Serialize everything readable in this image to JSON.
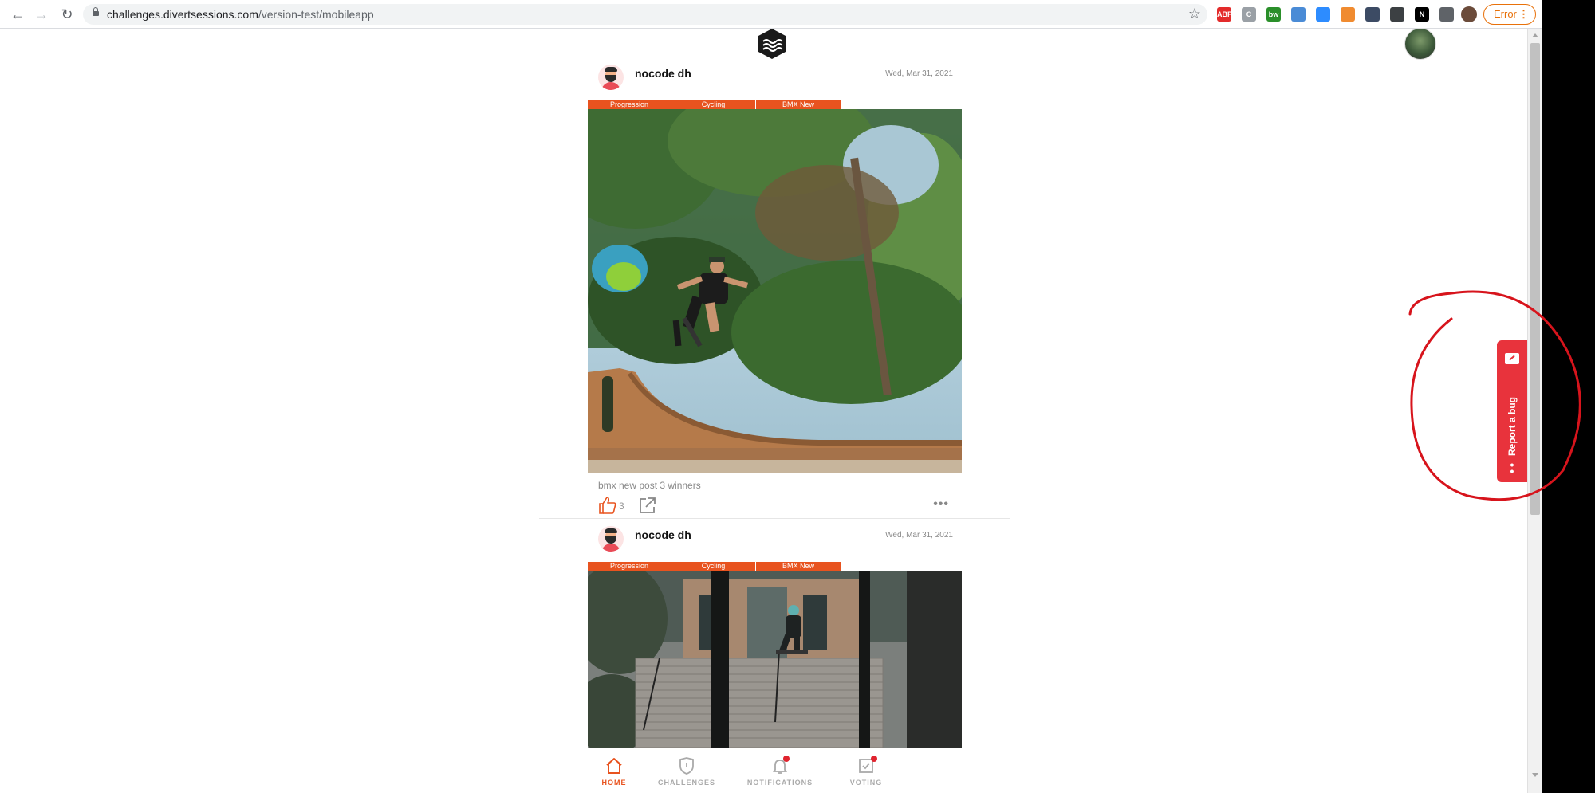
{
  "browser": {
    "url_domain": "challenges.divertsessions.com",
    "url_path": "/version-test/mobileapp",
    "error_label": "Error",
    "extensions": [
      {
        "name": "adblock-icon",
        "text": "ABP",
        "color": "#e32b2b"
      },
      {
        "name": "clipboard-ext-icon",
        "text": "C",
        "color": "#9aa0a6"
      },
      {
        "name": "bw-ext-icon",
        "text": "bw",
        "color": "#2a8f2a"
      },
      {
        "name": "image-ext-icon",
        "text": "",
        "color": "#4a8bd6"
      },
      {
        "name": "zoom-ext-icon",
        "text": "",
        "color": "#2d8cff"
      },
      {
        "name": "grid-ext-icon",
        "text": "",
        "color": "#f08b30"
      },
      {
        "name": "moon-ext-icon",
        "text": "",
        "color": "#3c4b64"
      },
      {
        "name": "screenshot-ext-icon",
        "text": "",
        "color": "#3c4043"
      },
      {
        "name": "notion-ext-icon",
        "text": "N",
        "color": "#000000"
      },
      {
        "name": "puzzle-ext-icon",
        "text": "",
        "color": "#5f6368"
      }
    ]
  },
  "posts": [
    {
      "username": "nocode dh",
      "date": "Wed, Mar 31, 2021",
      "tags": [
        "Progression",
        "Cycling",
        "BMX New"
      ],
      "caption": "bmx new post 3 winners",
      "likes": "3"
    },
    {
      "username": "nocode dh",
      "date": "Wed, Mar 31, 2021",
      "tags": [
        "Progression",
        "Cycling",
        "BMX New"
      ]
    }
  ],
  "nav": {
    "home": "HOME",
    "challenges": "CHALLENGES",
    "notifications": "NOTIFICATIONS",
    "voting": "VOTING"
  },
  "bug_widget": {
    "label": "Report a bug"
  },
  "colors": {
    "accent": "#e8531f",
    "bug": "#e8333c",
    "annotation": "#d7141c"
  }
}
